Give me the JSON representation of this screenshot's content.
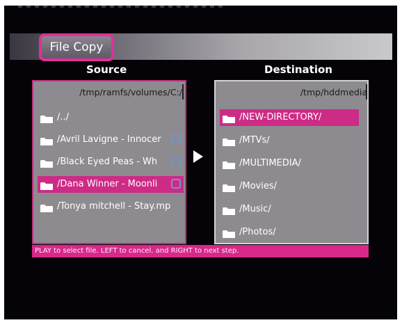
{
  "window": {
    "title": "File Copy"
  },
  "columns": {
    "source": "Source",
    "destination": "Destination"
  },
  "source": {
    "path": "/tmp/ramfs/volumes/C:/",
    "items": [
      {
        "label": "/../",
        "checkbox": false,
        "selected": false
      },
      {
        "label": "/Avril Lavigne - Innocer",
        "checkbox": true,
        "selected": false
      },
      {
        "label": "/Black Eyed Peas - Wh",
        "checkbox": true,
        "selected": false
      },
      {
        "label": "/Dana Winner - Moonli",
        "checkbox": true,
        "selected": true
      },
      {
        "label": "/Tonya mitchell - Stay.mp",
        "checkbox": false,
        "selected": false
      }
    ]
  },
  "destination": {
    "path": "/tmp/hddmedia",
    "items": [
      {
        "label": "/NEW-DIRECTORY/",
        "selected": true
      },
      {
        "label": "/MTVs/",
        "selected": false
      },
      {
        "label": "/MULTIMEDIA/",
        "selected": false
      },
      {
        "label": "/Movies/",
        "selected": false
      },
      {
        "label": "/Music/",
        "selected": false
      },
      {
        "label": "/Photos/",
        "selected": false
      }
    ]
  },
  "help": {
    "text": "PLAY to select file. LEFT to cancel. and RIGHT to next step."
  },
  "icons": {
    "folder": "folder-icon",
    "arrow": "arrow-right-icon",
    "checkbox": "checkbox-icon"
  },
  "colors": {
    "accent": "#cd2b86",
    "panel": "#8d8b90",
    "checkbox": "#6a96d8"
  }
}
